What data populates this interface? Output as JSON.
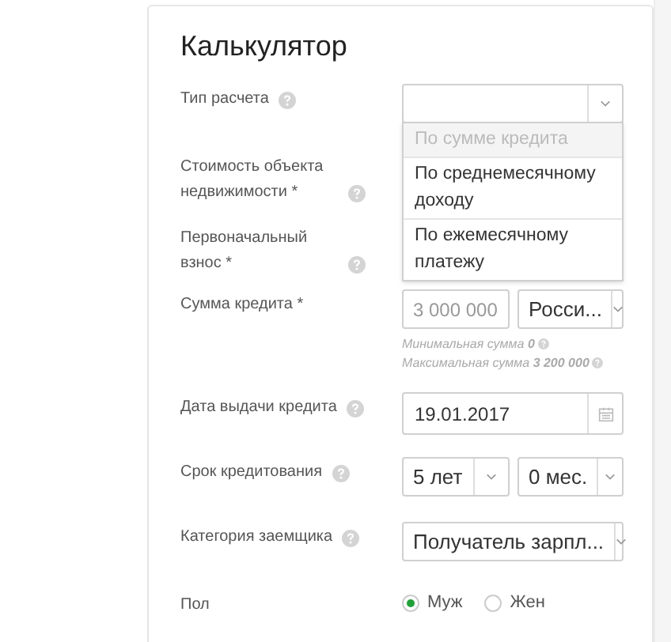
{
  "title": "Калькулятор",
  "rows": [
    {
      "kind": "select",
      "label": "Тип расчета",
      "help": true,
      "value": "",
      "open": true,
      "options": [
        {
          "label": "По сумме кредита",
          "disabled": true
        },
        {
          "label": "По среднемесячному доходу",
          "disabled": false
        },
        {
          "label": "По ежемесячному платежу",
          "disabled": false
        }
      ]
    },
    {
      "kind": "label_only",
      "label": "Стоимость объекта недвижимости *",
      "help": true
    },
    {
      "kind": "label_only",
      "label": "Первоначальный взнос *",
      "help": true
    },
    {
      "kind": "money",
      "label": "Сумма кредита *",
      "help": false,
      "amount": "3 000 000",
      "currency": "Росси...",
      "hints": [
        "Минимальная сумма **0**",
        "Максимальная сумма **3 200 000**"
      ]
    },
    {
      "kind": "date",
      "label": "Дата выдачи кредита",
      "help": true,
      "value": "19.01.2017"
    },
    {
      "kind": "term",
      "label": "Срок кредитования",
      "help": true,
      "years": "5 лет",
      "months": "0 мес."
    },
    {
      "kind": "select",
      "label": "Категория заемщика",
      "help": true,
      "value": "Получатель зарпл...",
      "open": false
    },
    {
      "kind": "radio",
      "label": "Пол",
      "help": false,
      "options": [
        {
          "label": "Муж",
          "selected": true
        },
        {
          "label": "Жен",
          "selected": false
        }
      ]
    }
  ]
}
